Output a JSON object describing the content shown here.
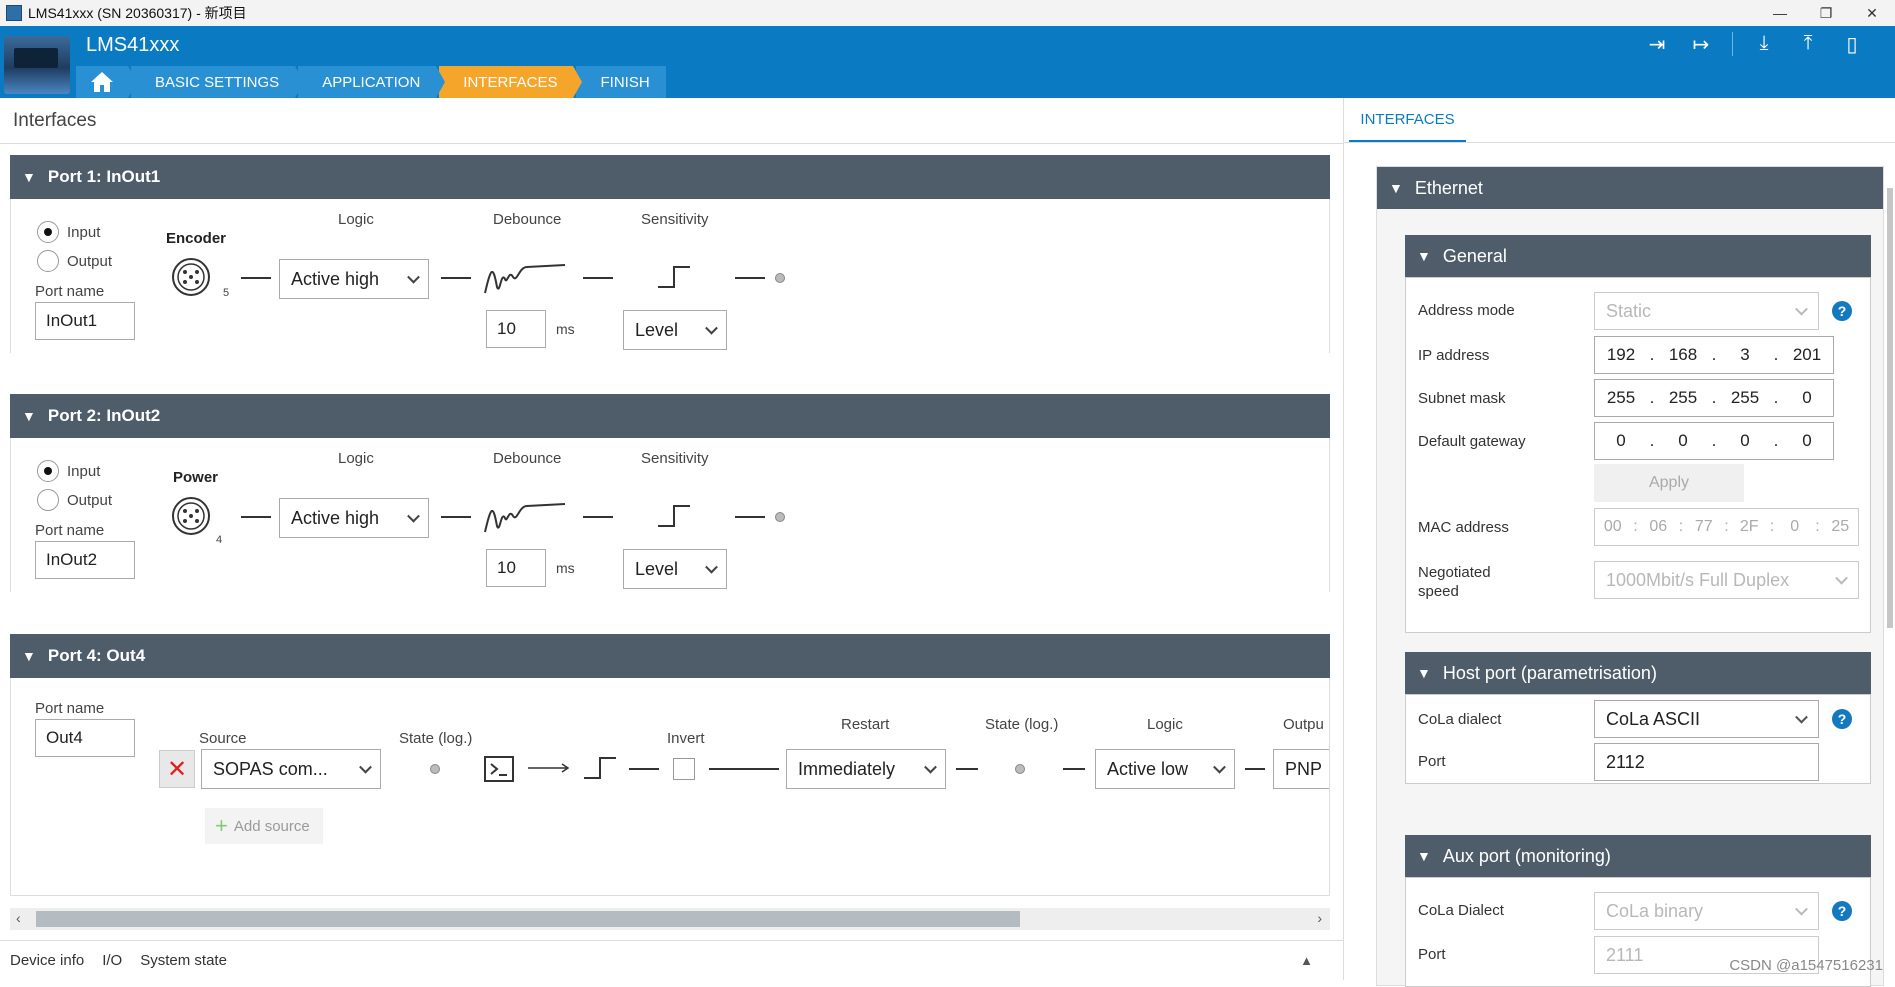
{
  "window": {
    "title": "LMS41xxx (SN 20360317) - 新项目",
    "controls": [
      "—",
      "❐",
      "✕"
    ]
  },
  "header": {
    "device_title": "LMS41xxx",
    "nav": [
      {
        "label": "BASIC SETTINGS",
        "active": false
      },
      {
        "label": "APPLICATION",
        "active": false
      },
      {
        "label": "INTERFACES",
        "active": true
      },
      {
        "label": "FINISH",
        "active": false
      }
    ],
    "tool_icons": [
      "login-icon",
      "logout-icon",
      "download-icon",
      "upload-icon",
      "device-icon"
    ]
  },
  "main": {
    "title": "Interfaces",
    "col_labels": {
      "logic": "Logic",
      "debounce": "Debounce",
      "sensitivity": "Sensitivity",
      "ms": "ms"
    },
    "port1": {
      "header": "Port 1:  InOut1",
      "input_label": "Input",
      "output_label": "Output",
      "mode": "Input",
      "port_name_label": "Port name",
      "port_name": "InOut1",
      "connector": "Encoder",
      "pin": "5",
      "logic": "Active high",
      "debounce": "10",
      "sensitivity": "Level"
    },
    "port2": {
      "header": "Port 2:  InOut2",
      "input_label": "Input",
      "output_label": "Output",
      "mode": "Input",
      "port_name_label": "Port name",
      "port_name": "InOut2",
      "connector": "Power",
      "pin": "4",
      "logic": "Active high",
      "debounce": "10",
      "sensitivity": "Level"
    },
    "port4": {
      "header": "Port 4:  Out4",
      "port_name_label": "Port name",
      "port_name": "Out4",
      "source_label": "Source",
      "source": "SOPAS com...",
      "state_label_1": "State (log.)",
      "invert_label": "Invert",
      "restart_label": "Restart",
      "restart": "Immediately",
      "state_label_2": "State (log.)",
      "logic_label": "Logic",
      "logic": "Active low",
      "output_label": "Outpu",
      "output": "PNP",
      "add_source": "Add source"
    }
  },
  "statusbar": {
    "items": [
      "Device info",
      "I/O",
      "System state"
    ]
  },
  "right": {
    "tab": "INTERFACES",
    "ethernet": {
      "header": "Ethernet",
      "general": {
        "header": "General",
        "address_mode_label": "Address mode",
        "address_mode": "Static",
        "ip_label": "IP address",
        "ip": [
          "192",
          "168",
          "3",
          "201"
        ],
        "subnet_label": "Subnet mask",
        "subnet": [
          "255",
          "255",
          "255",
          "0"
        ],
        "gateway_label": "Default gateway",
        "gateway": [
          "0",
          "0",
          "0",
          "0"
        ],
        "apply": "Apply",
        "mac_label": "MAC address",
        "mac": [
          "00",
          "06",
          "77",
          "2F",
          "0",
          "25"
        ],
        "speed_label_1": "Negotiated",
        "speed_label_2": "speed",
        "speed": "1000Mbit/s Full Duplex"
      },
      "host_port": {
        "header": "Host port (parametrisation)",
        "dialect_label": "CoLa dialect",
        "dialect": "CoLa ASCII",
        "port_label": "Port",
        "port": "2112"
      },
      "aux_port": {
        "header": "Aux port (monitoring)",
        "dialect_label": "CoLa Dialect",
        "dialect": "CoLa binary",
        "port_label": "Port",
        "port": "2111"
      }
    },
    "watermark": "CSDN @a1547516231"
  },
  "colors": {
    "header_blue": "#0a7bc2",
    "active_step": "#f4a52a",
    "section_header": "#4f5d6a",
    "delete_red": "#e0201a",
    "help_blue": "#1479bf"
  }
}
